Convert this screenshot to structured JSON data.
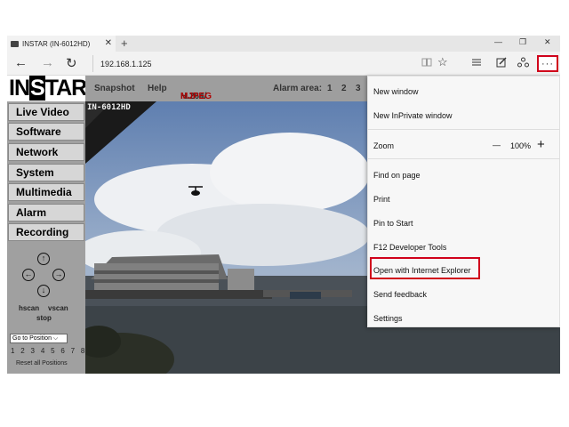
{
  "browser": {
    "tab_title": "INSTAR (IN-6012HD)",
    "tab_close": "✕",
    "new_tab": "+",
    "win_min": "—",
    "win_restore": "❐",
    "win_close": "✕",
    "back": "←",
    "forward": "→",
    "refresh": "↻",
    "address": "192.168.1.125",
    "more_label": "···",
    "accent_red": "#d0021b"
  },
  "camera": {
    "logo_left": "IN",
    "logo_highlight": "S",
    "logo_right": "TAR",
    "topbar": {
      "snapshot": "Snapshot",
      "help": "Help",
      "codec_h264": "H.264/",
      "codec_mjpeg": "MJPEG",
      "alarm_area": "Alarm area:",
      "areas": [
        "1",
        "2",
        "3"
      ]
    },
    "nav": [
      "Live Video",
      "Software",
      "Network",
      "System",
      "Multimedia",
      "Alarm",
      "Recording"
    ],
    "ptz": {
      "up": "↑",
      "down": "↓",
      "left": "←",
      "right": "→"
    },
    "hscan": "hscan",
    "vscan": "vscan",
    "stop": "stop",
    "goto_position": "Go to Position",
    "positions": "1 2 3 4 5 6 7 8",
    "reset_all": "Reset all Positions",
    "osd_label": "IN-6012HD"
  },
  "menu": {
    "new_window": "New window",
    "new_inprivate": "New InPrivate window",
    "zoom_label": "Zoom",
    "zoom_minus": "—",
    "zoom_value": "100%",
    "zoom_plus": "+",
    "find_on_page": "Find on page",
    "print": "Print",
    "pin_to_start": "Pin to Start",
    "dev_tools": "F12 Developer Tools",
    "open_with_ie": "Open with Internet Explorer",
    "send_feedback": "Send feedback",
    "settings": "Settings"
  }
}
